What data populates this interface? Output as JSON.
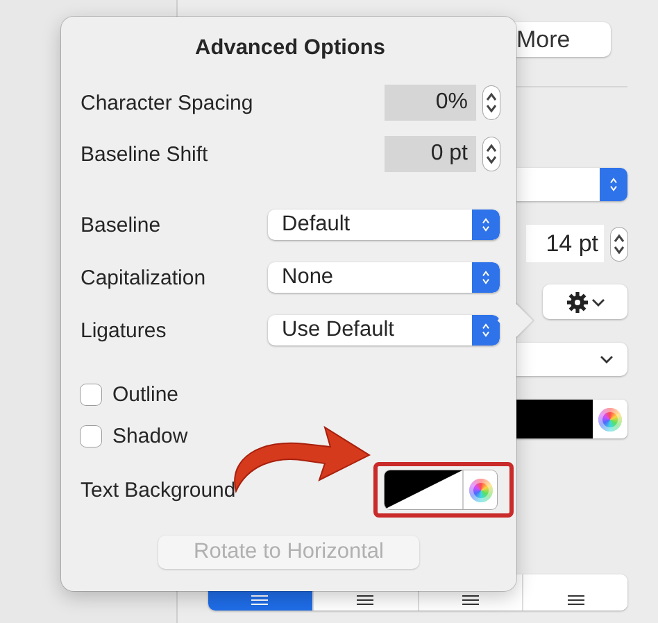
{
  "inspector": {
    "more_button": "More",
    "font_size": "14 pt",
    "alignment": [
      {
        "selected": true
      },
      {
        "selected": false
      },
      {
        "selected": false
      },
      {
        "selected": false
      }
    ]
  },
  "popover": {
    "title": "Advanced Options",
    "steppers": [
      {
        "label": "Character Spacing",
        "value": "0%"
      },
      {
        "label": "Baseline Shift",
        "value": "0 pt"
      }
    ],
    "popups": [
      {
        "label": "Baseline",
        "value": "Default"
      },
      {
        "label": "Capitalization",
        "value": "None"
      },
      {
        "label": "Ligatures",
        "value": "Use Default"
      }
    ],
    "checkboxes": [
      {
        "label": "Outline",
        "checked": false
      },
      {
        "label": "Shadow",
        "checked": false
      }
    ],
    "text_background": {
      "label": "Text Background"
    },
    "rotate_button": {
      "label": "Rotate to Horizontal",
      "disabled": true
    }
  }
}
